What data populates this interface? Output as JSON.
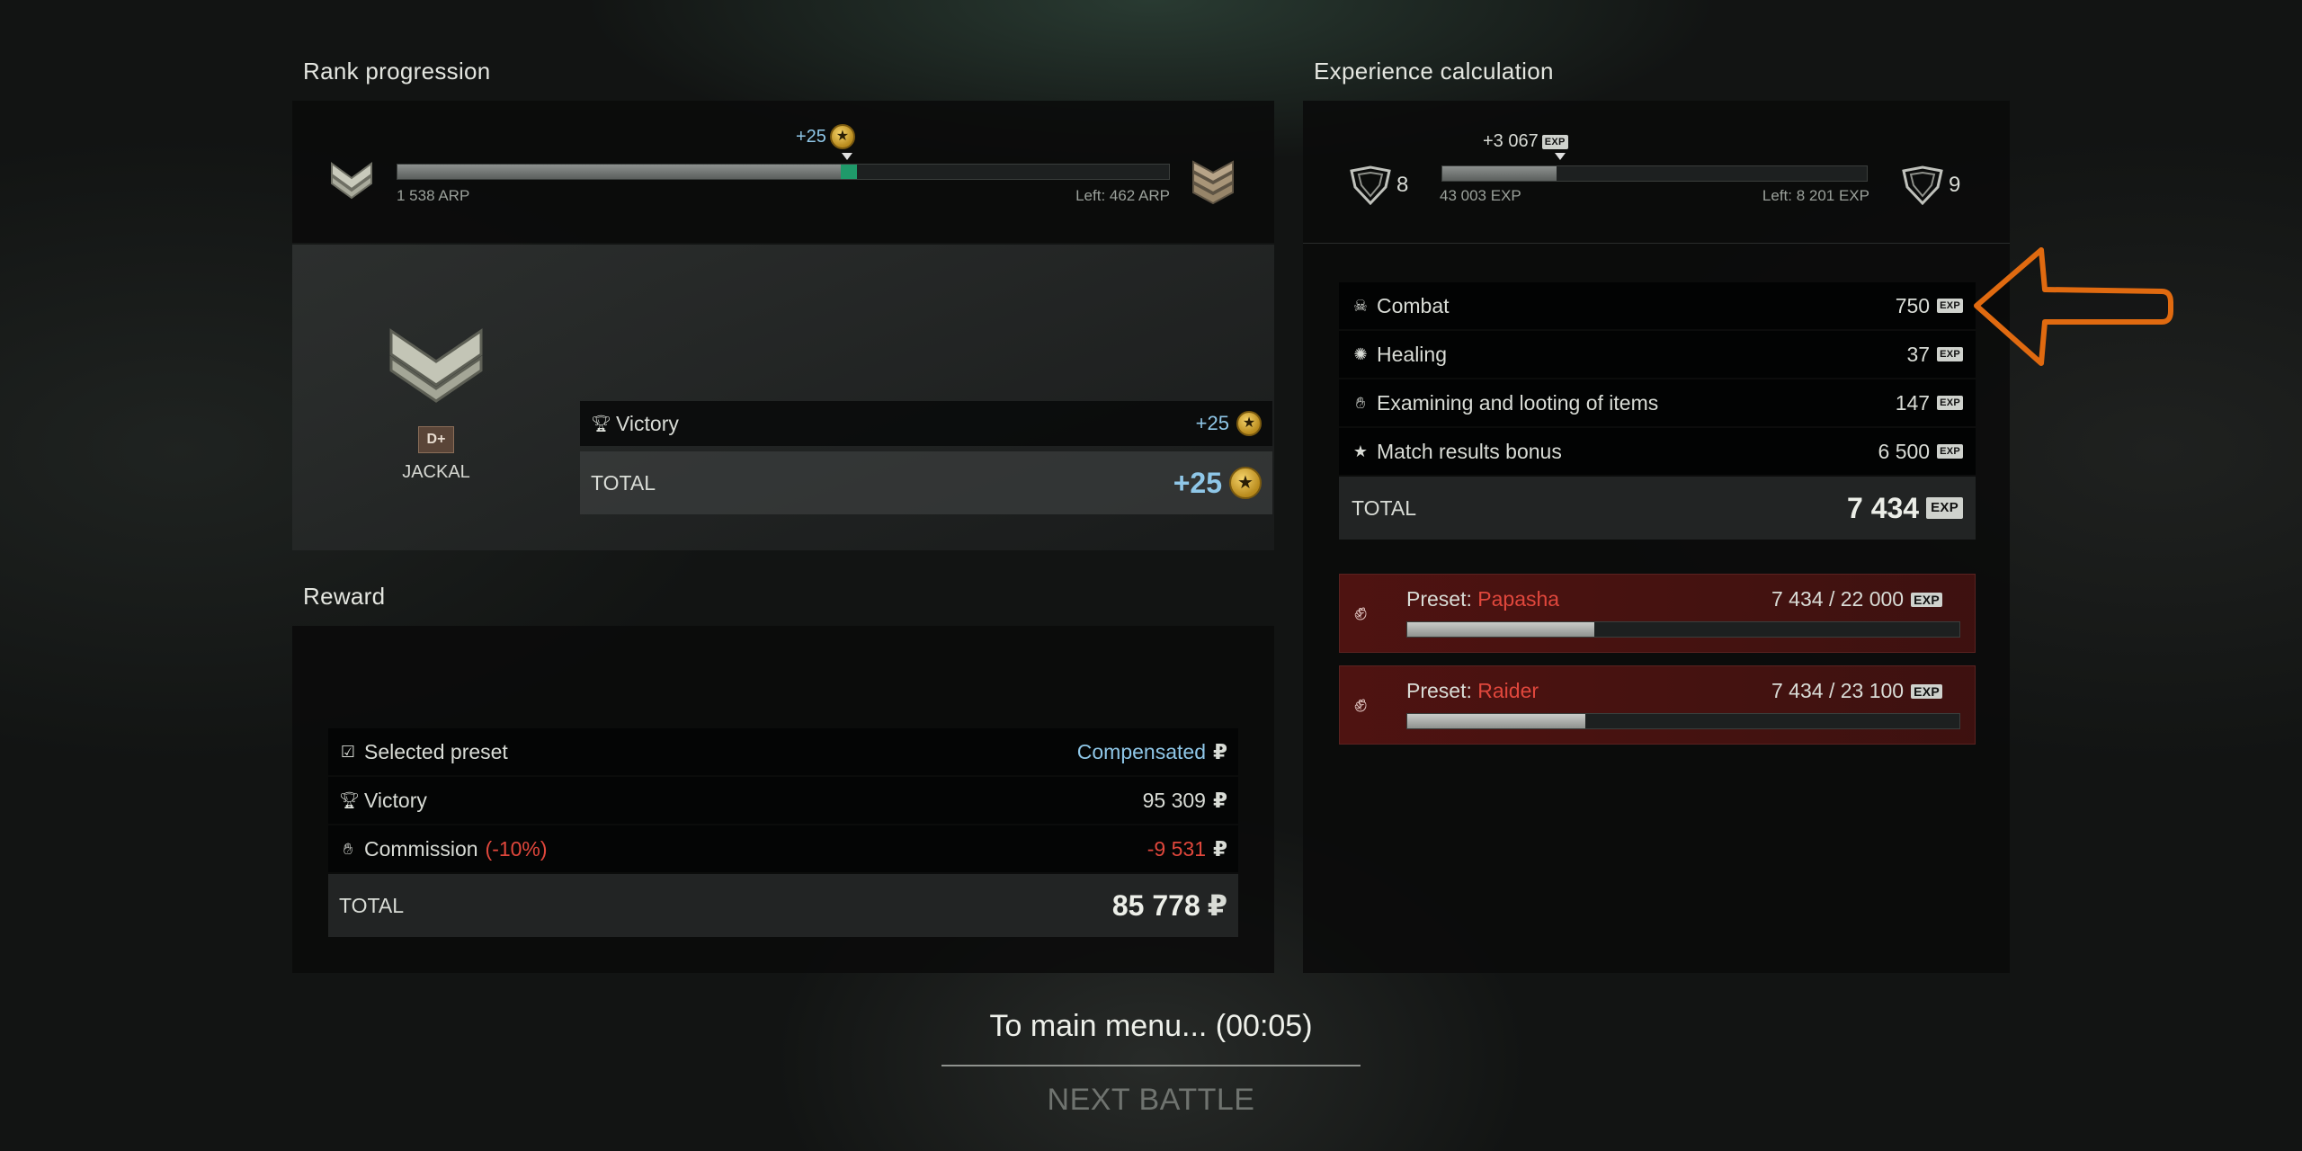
{
  "rank": {
    "section_title": "Rank progression",
    "gain": "+25",
    "current_points": "1 538 ARP",
    "left_points": "Left: 462 ARP",
    "progress_fraction": 0.575,
    "gain_fraction": 0.02,
    "rank_name": "JACKAL",
    "rank_badge": "D+",
    "victory_label": "Victory",
    "victory_value": "+25",
    "total_label": "TOTAL",
    "total_value": "+25"
  },
  "experience": {
    "section_title": "Experience calculation",
    "gain": "+3 067",
    "level_current": "8",
    "level_next": "9",
    "current_exp": "43 003 EXP",
    "left_exp": "Left: 8 201 EXP",
    "progress_fraction": 0.27,
    "badge": "EXP",
    "items": [
      {
        "icon": "skull-icon",
        "label": "Combat",
        "value": "750"
      },
      {
        "icon": "bandage-icon",
        "label": "Healing",
        "value": "37"
      },
      {
        "icon": "hand-icon",
        "label": "Examining and looting of items",
        "value": "147"
      },
      {
        "icon": "star-icon",
        "label": "Match results bonus",
        "value": "6 500"
      }
    ],
    "total_label": "TOTAL",
    "total_value": "7 434",
    "presets": [
      {
        "prefix": "Preset: ",
        "name": "Papasha",
        "progress": "7 434 / 22 000",
        "fraction": 0.338
      },
      {
        "prefix": "Preset: ",
        "name": "Raider",
        "progress": "7 434 / 23 100",
        "fraction": 0.322
      }
    ]
  },
  "reward": {
    "section_title": "Reward",
    "selected_preset_label": "Selected preset",
    "selected_preset_value": "Compensated",
    "victory_label": "Victory",
    "victory_value": "95 309",
    "commission_label": "Commission",
    "commission_pct": "(-10%)",
    "commission_value": "-9 531",
    "total_label": "TOTAL",
    "total_value": "85 778",
    "currency": "₽"
  },
  "footer": {
    "main_menu": "To main menu... (00:05)",
    "next_battle": "NEXT BATTLE"
  },
  "colors": {
    "accent_blue": "#8fc7e8",
    "accent_red": "#e0473c",
    "rank_gain_green": "#1f9a6a",
    "arrow_orange": "#e06a10"
  }
}
